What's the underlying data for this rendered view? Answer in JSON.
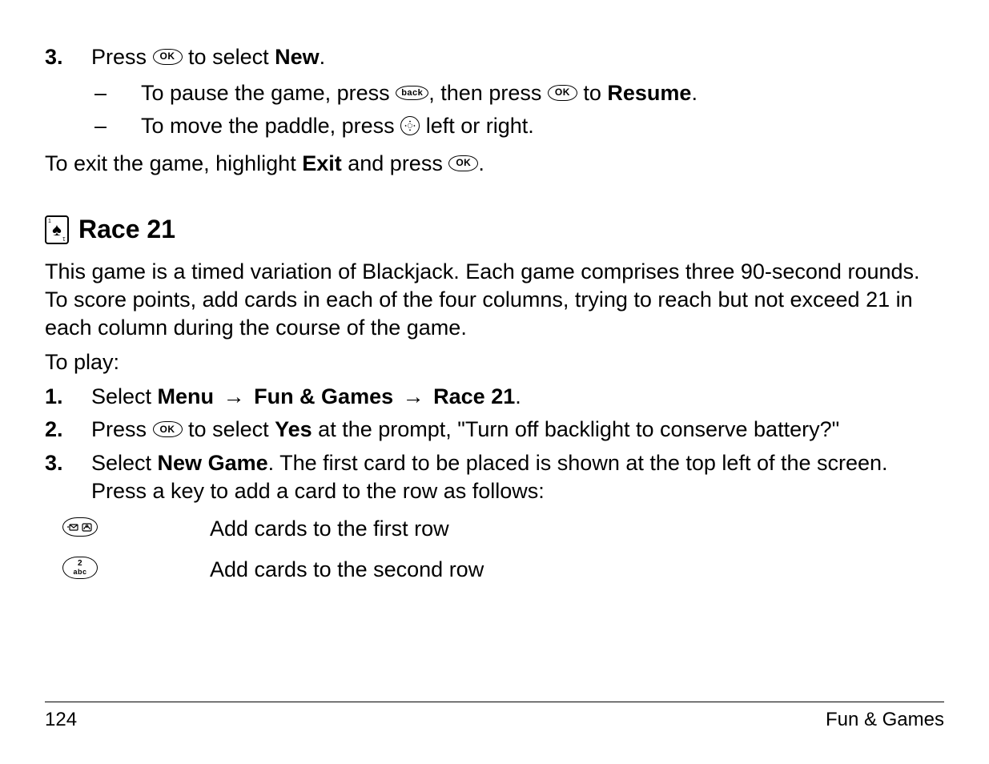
{
  "step3": {
    "num": "3.",
    "pre": "Press ",
    "post": " to select ",
    "bold": "New",
    "end": "."
  },
  "sub1": {
    "pre": "To pause the game, press ",
    "mid": ", then press ",
    "post": " to ",
    "bold": "Resume",
    "end": "."
  },
  "sub2": {
    "pre": "To move the paddle, press ",
    "post": " left or right."
  },
  "exit": {
    "pre": "To exit the game, highlight ",
    "bold": "Exit",
    "mid": " and press ",
    "end": "."
  },
  "heading": "Race 21",
  "desc": "This game is a timed variation of Blackjack. Each game comprises three 90-second rounds. To score points, add cards in each of the four columns, trying to reach but not exceed 21 in each column during the course of the game.",
  "toplay": "To play:",
  "r1": {
    "num": "1.",
    "a": "Select ",
    "b1": "Menu",
    "arr": "→",
    "b2": "Fun & Games",
    "b3": "Race 21",
    "end": "."
  },
  "r2": {
    "num": "2.",
    "a": "Press ",
    "b": " to select ",
    "bold": "Yes",
    "c": " at the prompt, \"Turn off backlight to conserve battery?\""
  },
  "r3": {
    "num": "3.",
    "a": "Select ",
    "bold": "New Game",
    "b": ". The first card to be placed is shown at the top left of the screen. Press a key to add a card to the row as follows:"
  },
  "krow1": "Add cards to the first row",
  "krow2": "Add cards to the second row",
  "key2top": "2",
  "key2bot": "abc",
  "footer": {
    "page": "124",
    "section": "Fun & Games"
  },
  "icons": {
    "ok": "OK",
    "back": "back"
  }
}
